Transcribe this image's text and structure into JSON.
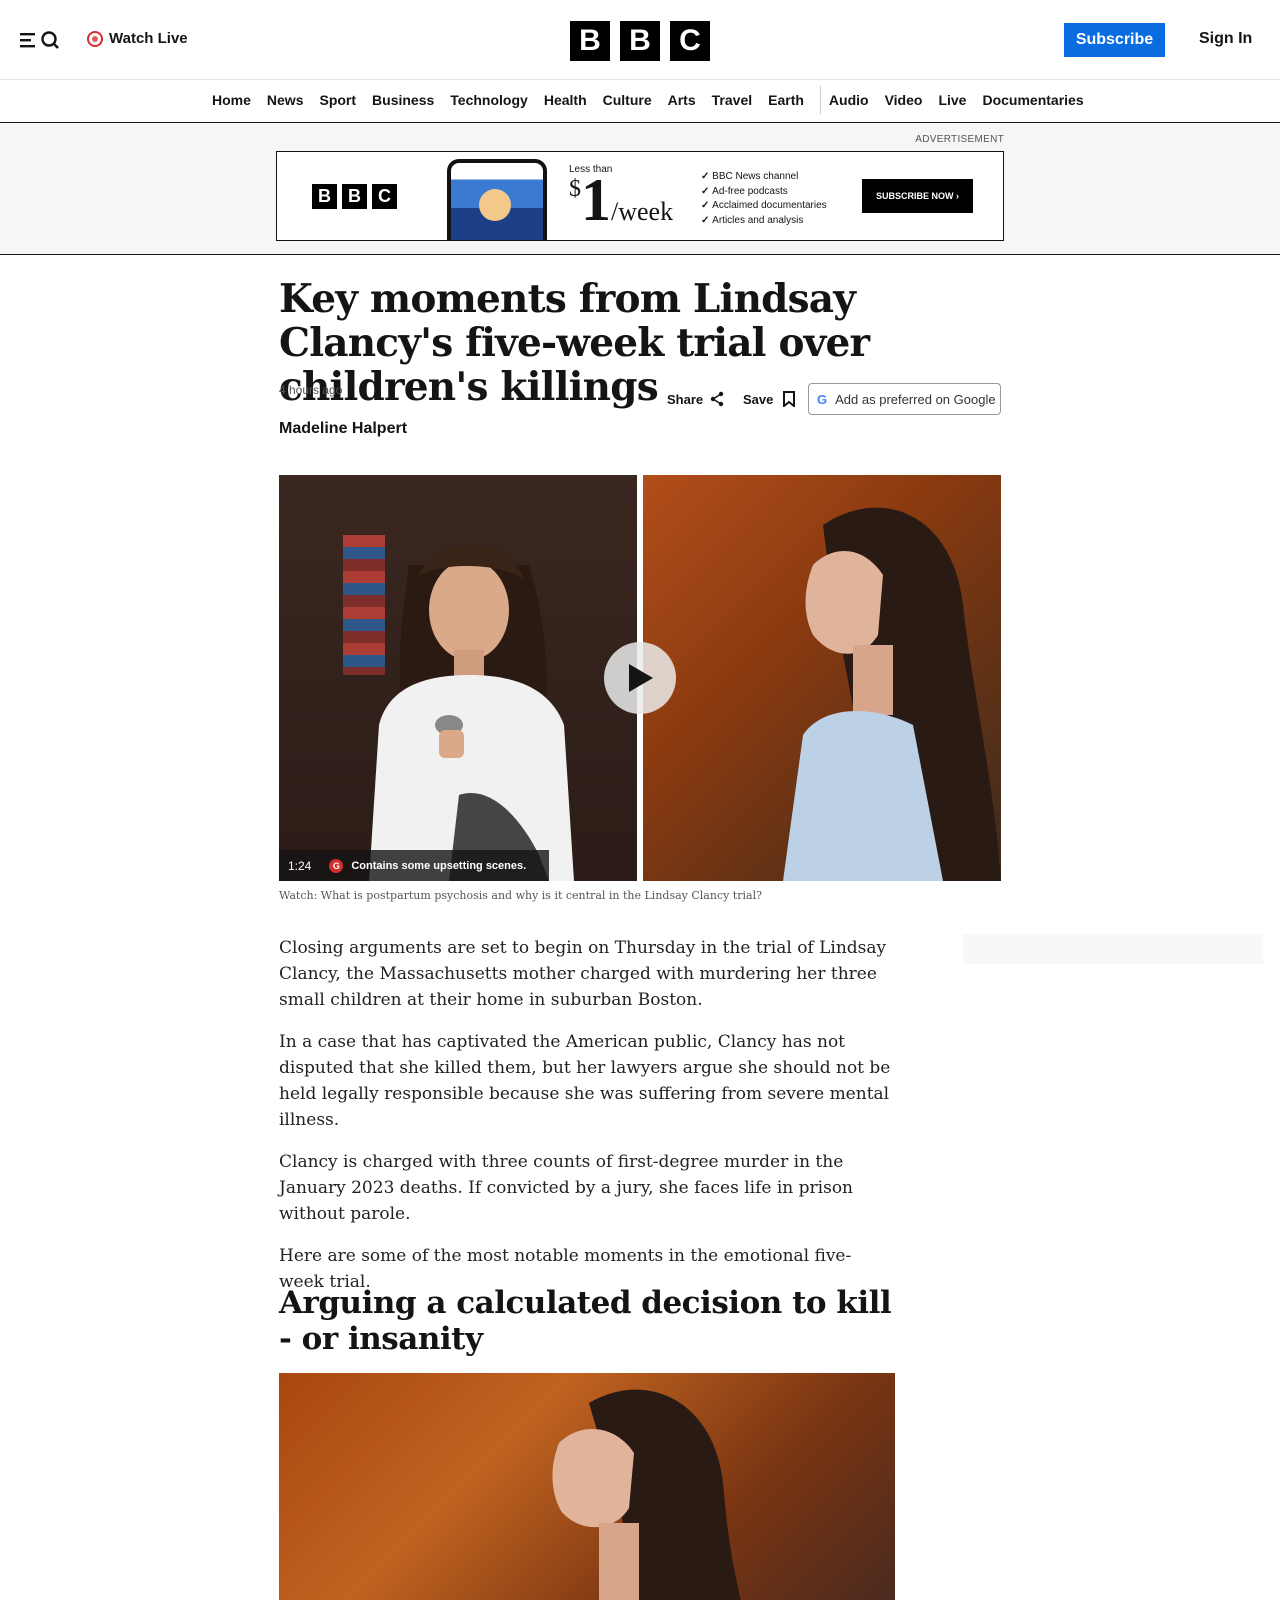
{
  "header": {
    "watch_live": "Watch Live",
    "logo_letters": [
      "B",
      "B",
      "C"
    ],
    "subscribe": "Subscribe",
    "sign_in": "Sign In"
  },
  "nav": {
    "items": [
      "Home",
      "News",
      "Sport",
      "Business",
      "Technology",
      "Health",
      "Culture",
      "Arts",
      "Travel",
      "Earth",
      "Audio",
      "Video",
      "Live",
      "Documentaries"
    ]
  },
  "ad": {
    "label": "ADVERTISEMENT",
    "logo_letters": [
      "B",
      "B",
      "C"
    ],
    "less_than": "Less than",
    "currency": "$",
    "amount": "1",
    "per": "/week",
    "features": [
      "BBC News channel",
      "Ad-free podcasts",
      "Acclaimed documentaries",
      "Articles and analysis"
    ],
    "cta": "SUBSCRIBE NOW ›"
  },
  "article": {
    "headline": "Key moments from Lindsay Clancy's five-week trial over children's killings",
    "timestamp": "4 hours ago",
    "author": "Madeline Halpert",
    "share": "Share",
    "save": "Save",
    "google_pref": "Add as preferred on Google",
    "video": {
      "duration": "1:24",
      "rating": "G",
      "warning": "Contains some upsetting scenes.",
      "caption": "Watch: What is postpartum psychosis and why is it central in the Lindsay Clancy trial?"
    },
    "paragraphs": [
      "Closing arguments are set to begin on Thursday in the trial of Lindsay Clancy, the Massachusetts mother charged with murdering her three small children at their home in suburban Boston.",
      "In a case that has captivated the American public, Clancy has not disputed that she killed them, but her lawyers argue she should not be held legally responsible because she was suffering from severe mental illness.",
      "Clancy is charged with three counts of first-degree murder in the January 2023 deaths. If convicted by a jury, she faces life in prison without parole.",
      "Here are some of the most notable moments in the emotional five-week trial."
    ],
    "subheading": "Arguing a calculated decision to kill - or insanity"
  },
  "colors": {
    "accent_blue": "#0a6ce1",
    "live_red": "#d42e2e"
  }
}
